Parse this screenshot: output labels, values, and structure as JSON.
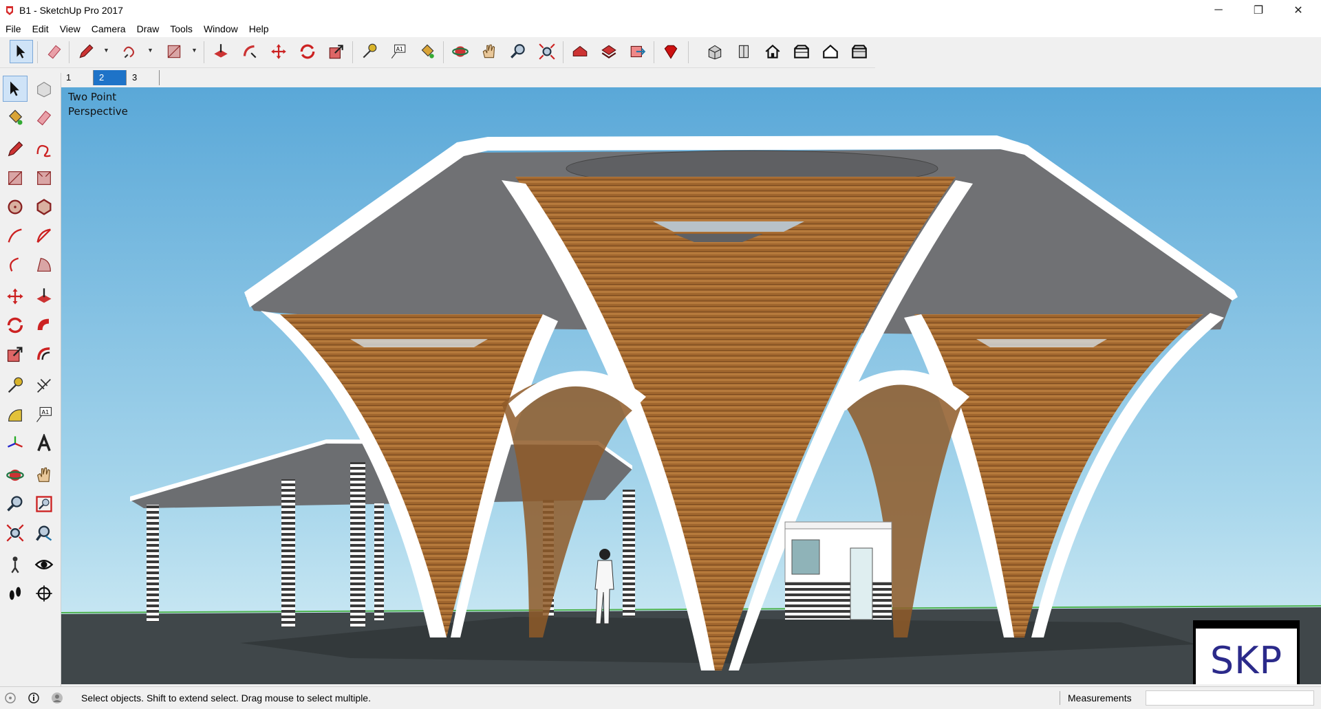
{
  "window": {
    "title": "B1 - SketchUp Pro 2017",
    "minimize_glyph": "─",
    "restore_glyph": "❐",
    "close_glyph": "✕"
  },
  "menu": [
    "File",
    "Edit",
    "View",
    "Camera",
    "Draw",
    "Tools",
    "Window",
    "Help"
  ],
  "scene_tabs": [
    "1",
    "2",
    "3"
  ],
  "active_scene_tab": "2",
  "toolbar_icons": [
    "select-icon",
    "eraser-icon",
    "pencil-icon",
    "freehand-icon",
    "rectangle-icon",
    "push-pull-icon",
    "follow-me-icon",
    "move-icon",
    "rotate-icon",
    "scale-icon",
    "tape-measure-icon",
    "text-icon",
    "paint-bucket-icon",
    "orbit-icon",
    "pan-icon",
    "zoom-icon",
    "zoom-extents-icon",
    "warehouse-icon",
    "extension-warehouse-icon",
    "send-to-layout-icon",
    "ruby-icon",
    "iso-view-icon",
    "front-view-icon",
    "home-view-icon",
    "right-view-icon",
    "back-view-icon",
    "top-view-icon"
  ],
  "viewport": {
    "camera_label_line1": "Two Point",
    "camera_label_line2": "Perspective",
    "badge_text": "SKP"
  },
  "status": {
    "message": "Select objects. Shift to extend select. Drag mouse to select multiple.",
    "measurements_label": "Measurements",
    "measurements_value": ""
  },
  "colors": {
    "sky_top": "#5aa8d8",
    "sky_bottom": "#cfeaf4",
    "ground": "#3e4346",
    "wood": "#a0662e",
    "roof_underside": "#6e6f72",
    "active_blue": "#1e73c8"
  }
}
